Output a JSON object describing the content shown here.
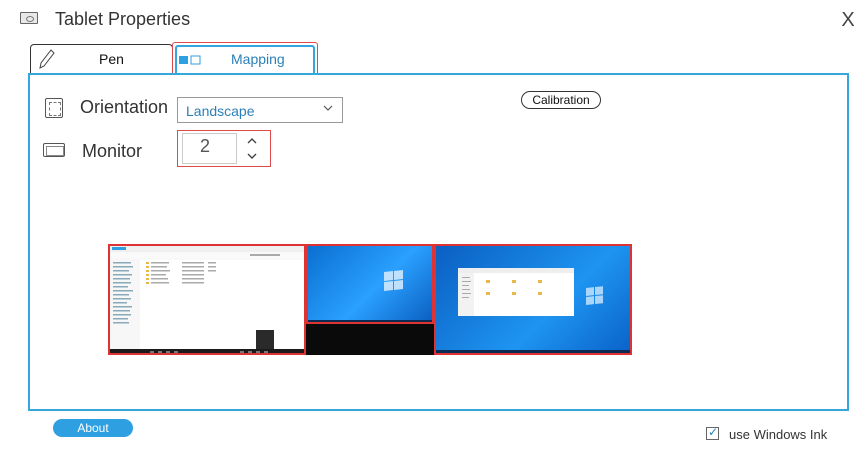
{
  "window": {
    "title": "Tablet Properties",
    "close_glyph": "X"
  },
  "tabs": [
    {
      "label": "Pen",
      "icon": "pen-icon",
      "active": false
    },
    {
      "label": "Mapping",
      "icon": "mapping-icon",
      "active": true
    }
  ],
  "mapping": {
    "orientation": {
      "label": "Orientation",
      "value": "Landscape"
    },
    "monitor": {
      "label": "Monitor",
      "value": "2"
    },
    "calibration_label": "Calibration"
  },
  "footer": {
    "about_label": "About",
    "windows_ink": {
      "label": "use Windows Ink",
      "checked": true
    }
  },
  "colors": {
    "accent": "#35a6de",
    "highlight": "#e04a4a",
    "button": "#2e9fe0"
  }
}
